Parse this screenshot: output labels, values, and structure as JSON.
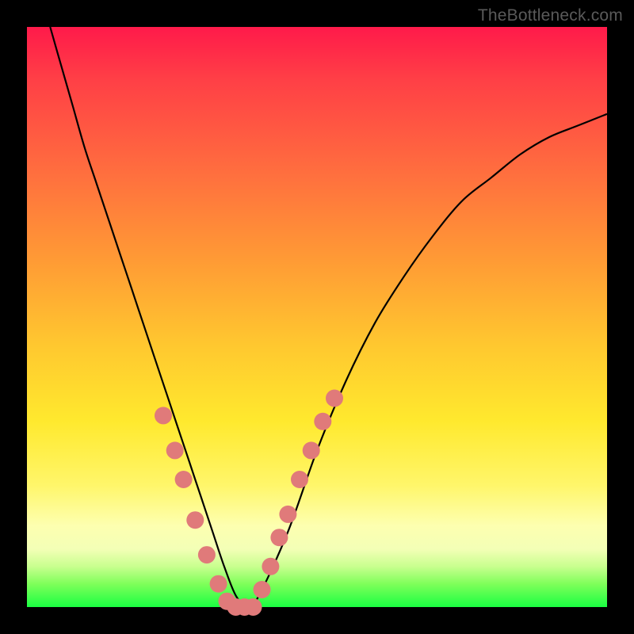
{
  "watermark": "TheBottleneck.com",
  "chart_data": {
    "type": "line",
    "title": "",
    "xlabel": "",
    "ylabel": "",
    "xlim": [
      0,
      100
    ],
    "ylim": [
      0,
      100
    ],
    "series": [
      {
        "name": "bottleneck-curve",
        "x": [
          4,
          6,
          8,
          10,
          12,
          14,
          16,
          18,
          20,
          22,
          24,
          26,
          28,
          30,
          32,
          34,
          36,
          38,
          40,
          45,
          50,
          55,
          60,
          65,
          70,
          75,
          80,
          85,
          90,
          95,
          100
        ],
        "y": [
          100,
          93,
          86,
          79,
          73,
          67,
          61,
          55,
          49,
          43,
          37,
          31,
          25,
          19,
          13,
          7,
          2,
          0,
          2,
          13,
          27,
          39,
          49,
          57,
          64,
          70,
          74,
          78,
          81,
          83,
          85
        ]
      }
    ],
    "markers": {
      "name": "highlight-dots",
      "color": "#e07a7a",
      "points": [
        {
          "x": 23.5,
          "y": 33
        },
        {
          "x": 25.5,
          "y": 27
        },
        {
          "x": 27.0,
          "y": 22
        },
        {
          "x": 29.0,
          "y": 15
        },
        {
          "x": 31.0,
          "y": 9
        },
        {
          "x": 33.0,
          "y": 4
        },
        {
          "x": 34.5,
          "y": 1
        },
        {
          "x": 36.0,
          "y": 0
        },
        {
          "x": 37.5,
          "y": 0
        },
        {
          "x": 39.0,
          "y": 0
        },
        {
          "x": 40.5,
          "y": 3
        },
        {
          "x": 42.0,
          "y": 7
        },
        {
          "x": 43.5,
          "y": 12
        },
        {
          "x": 45.0,
          "y": 16
        },
        {
          "x": 47.0,
          "y": 22
        },
        {
          "x": 49.0,
          "y": 27
        },
        {
          "x": 51.0,
          "y": 32
        },
        {
          "x": 53.0,
          "y": 36
        }
      ]
    }
  },
  "colors": {
    "marker_fill": "#e07a7a",
    "curve_stroke": "#000000",
    "frame_bg": "#000000"
  }
}
